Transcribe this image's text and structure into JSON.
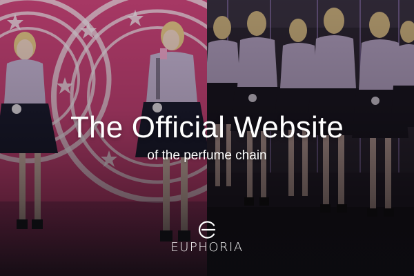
{
  "hero": {
    "headline": "The Official Website",
    "subline": "of the perfume chain"
  },
  "brand": {
    "name": "EUPHORIA",
    "logo_icon": "euphoria-e-logo-icon"
  },
  "colors": {
    "left_background": "#d2477f",
    "right_background": "#2a2430",
    "text": "#ffffff"
  }
}
